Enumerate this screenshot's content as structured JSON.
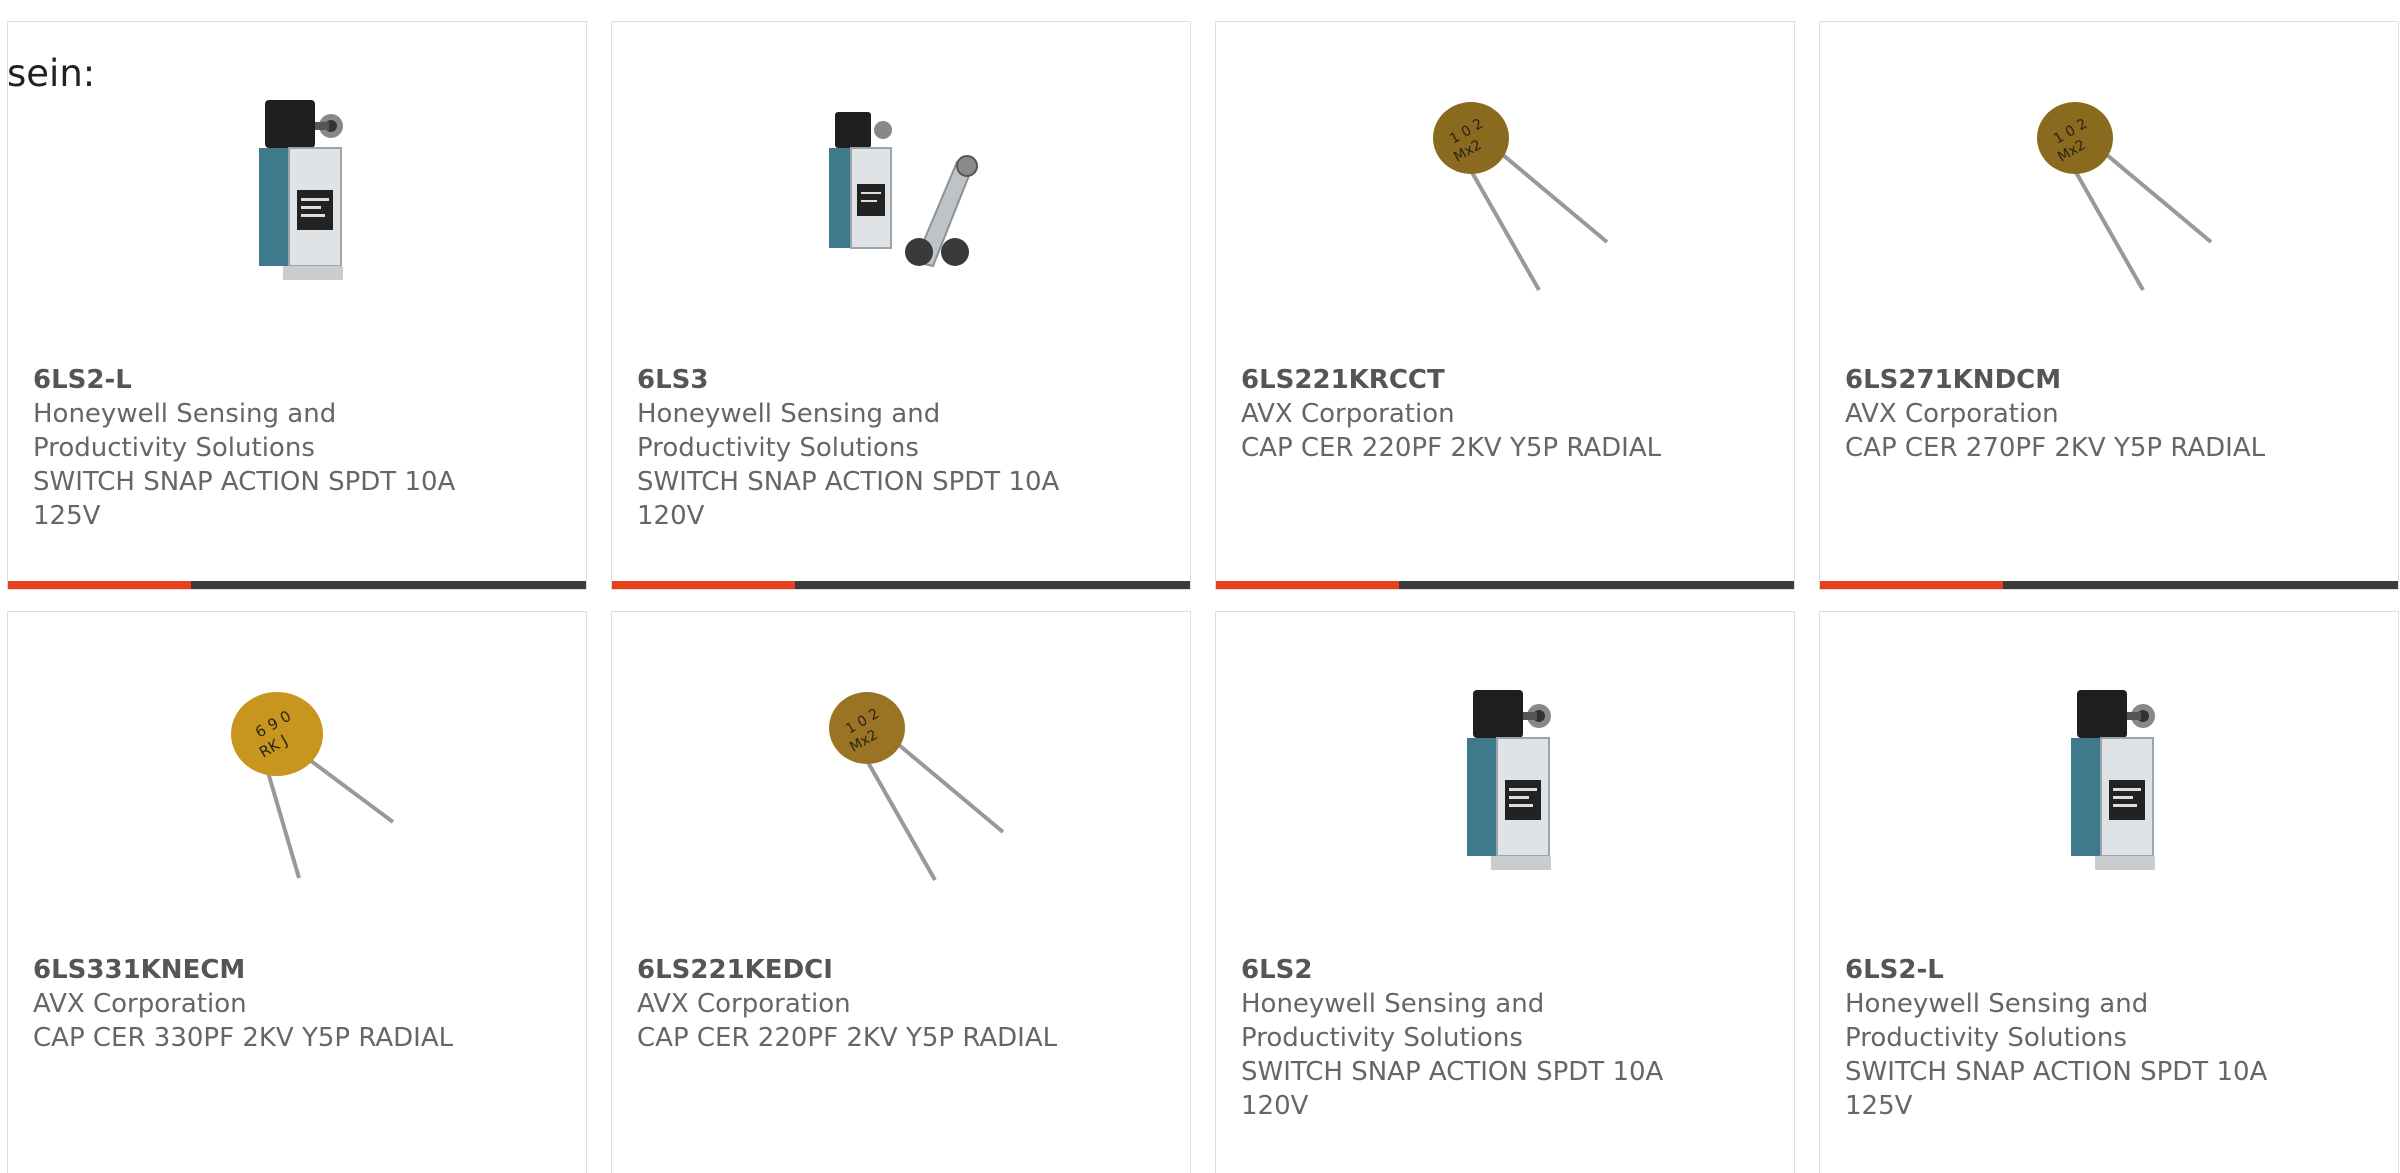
{
  "intro": {
    "text": "sein:"
  },
  "colors": {
    "accent": "#e8401c",
    "bar": "#3c3c3c",
    "border": "#dedede"
  },
  "products": [
    {
      "part_number": "6LS2-L",
      "manufacturer": "Honeywell Sensing and Productivity Solutions",
      "description": "SWITCH SNAP ACTION SPDT 10A 125V",
      "image": "limit-switch"
    },
    {
      "part_number": "6LS3",
      "manufacturer": "Honeywell Sensing and Productivity Solutions",
      "description": "SWITCH SNAP ACTION SPDT 10A 120V",
      "image": "limit-switch-roller"
    },
    {
      "part_number": "6LS221KRCCT",
      "manufacturer": "AVX Corporation",
      "description": "CAP CER 220PF 2KV Y5P RADIAL",
      "image": "ceramic-capacitor"
    },
    {
      "part_number": "6LS271KNDCM",
      "manufacturer": "AVX Corporation",
      "description": "CAP CER 270PF 2KV Y5P RADIAL",
      "image": "ceramic-capacitor"
    },
    {
      "part_number": "6LS331KNECM",
      "manufacturer": "AVX Corporation",
      "description": "CAP CER 330PF 2KV Y5P RADIAL",
      "image": "ceramic-capacitor-yellow"
    },
    {
      "part_number": "6LS221KEDCI",
      "manufacturer": "AVX Corporation",
      "description": "CAP CER 220PF 2KV Y5P RADIAL",
      "image": "ceramic-capacitor"
    },
    {
      "part_number": "6LS2",
      "manufacturer": "Honeywell Sensing and Productivity Solutions",
      "description": "SWITCH SNAP ACTION SPDT 10A 120V",
      "image": "limit-switch"
    },
    {
      "part_number": "6LS2-L",
      "manufacturer": "Honeywell Sensing and Productivity Solutions",
      "description": "SWITCH SNAP ACTION SPDT 10A 125V",
      "image": "limit-switch"
    }
  ]
}
